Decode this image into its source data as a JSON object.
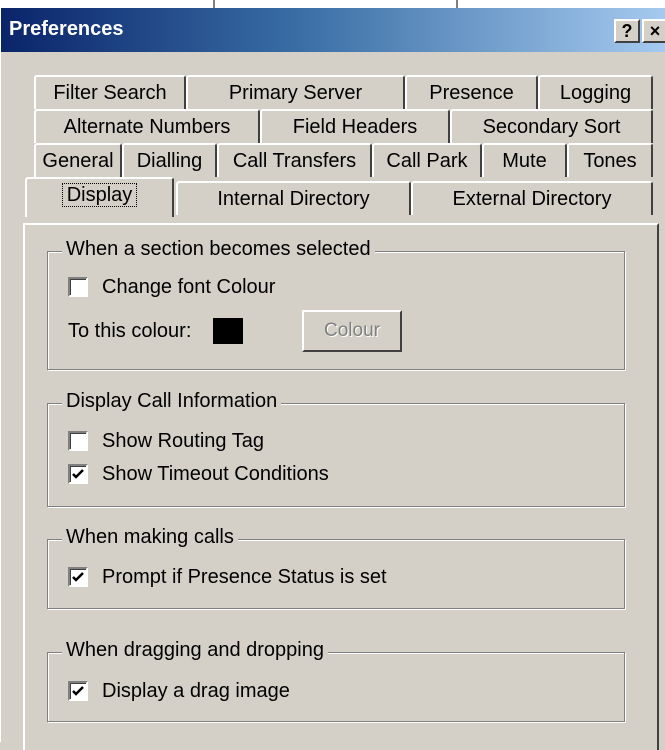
{
  "window": {
    "title": "Preferences",
    "help_label": "?",
    "close_label": "×"
  },
  "tabs": {
    "row1": [
      "Filter Search",
      "Primary Server",
      "Presence",
      "Logging"
    ],
    "row2": [
      "Alternate Numbers",
      "Field Headers",
      "Secondary Sort"
    ],
    "row3": [
      "General",
      "Dialling",
      "Call Transfers",
      "Call Park",
      "Mute",
      "Tones"
    ],
    "row4": [
      "Display",
      "Internal Directory",
      "External Directory"
    ],
    "active": "Display"
  },
  "display": {
    "section_selected": {
      "title": "When a section becomes selected",
      "change_font_colour": {
        "label": "Change font Colour",
        "checked": false
      },
      "to_this_colour_label": "To this colour:",
      "swatch_color": "#000000",
      "colour_button": "Colour"
    },
    "call_info": {
      "title": "Display Call Information",
      "show_routing_tag": {
        "label": "Show Routing Tag",
        "checked": false
      },
      "show_timeout_conditions": {
        "label": "Show Timeout Conditions",
        "checked": true
      }
    },
    "making_calls": {
      "title": "When making calls",
      "prompt_presence": {
        "label": "Prompt if Presence Status is set",
        "checked": true
      }
    },
    "dragging": {
      "title": "When dragging and dropping",
      "display_drag_image": {
        "label": "Display a drag image",
        "checked": true
      }
    }
  }
}
